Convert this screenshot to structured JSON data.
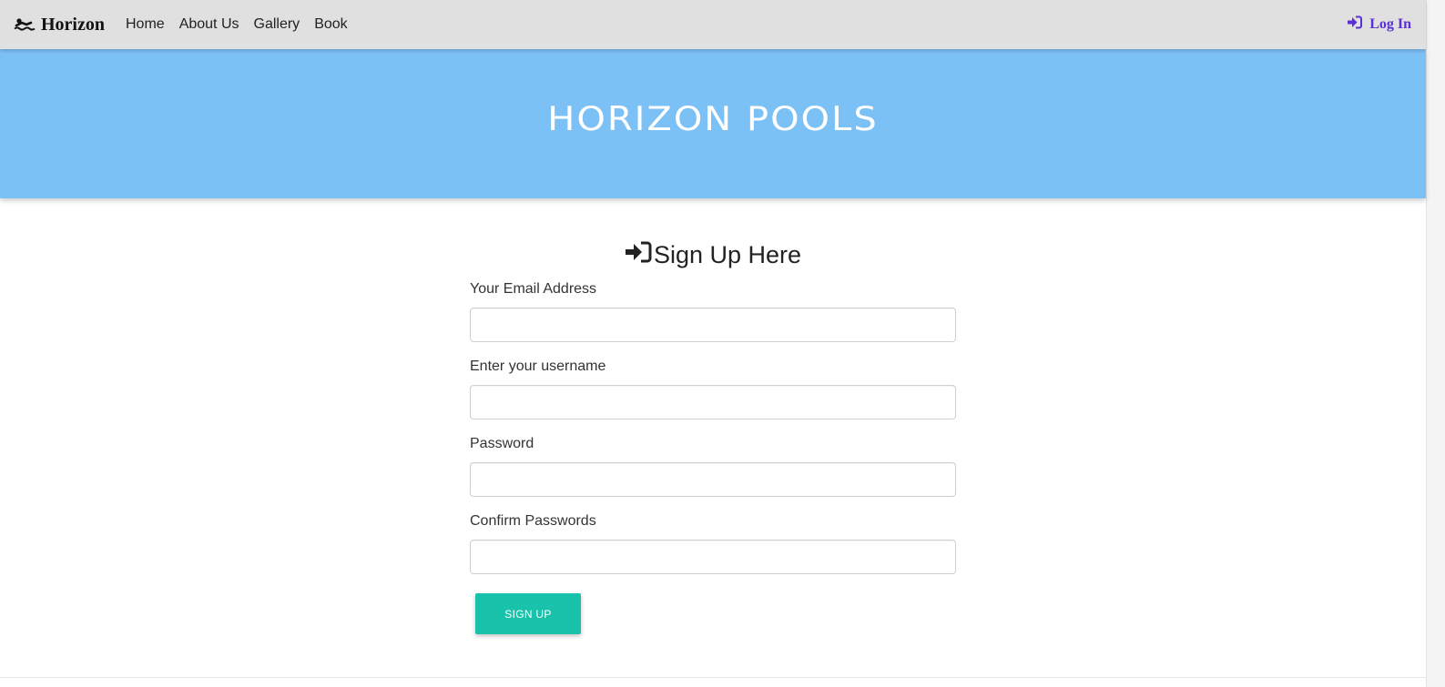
{
  "navbar": {
    "brand": "Horizon",
    "brand_icon": "swimmer-icon",
    "links": [
      "Home",
      "About Us",
      "Gallery",
      "Book"
    ],
    "login_label": "Log In",
    "login_icon": "sign-in-icon",
    "background": "#e0e0e0",
    "login_color": "#5b2fd6"
  },
  "hero": {
    "title": "HORIZON POOLS",
    "background": "#7cc1f6"
  },
  "form": {
    "heading": "Sign Up Here",
    "heading_icon": "sign-in-icon",
    "fields": [
      {
        "label": "Your Email Address",
        "value": "",
        "placeholder": ""
      },
      {
        "label": "Enter your username",
        "value": "",
        "placeholder": ""
      },
      {
        "label": "Password",
        "value": "",
        "placeholder": ""
      },
      {
        "label": "Confirm Passwords",
        "value": "",
        "placeholder": ""
      }
    ],
    "submit_label": "SIGN UP",
    "submit_color": "#18c2ab"
  }
}
